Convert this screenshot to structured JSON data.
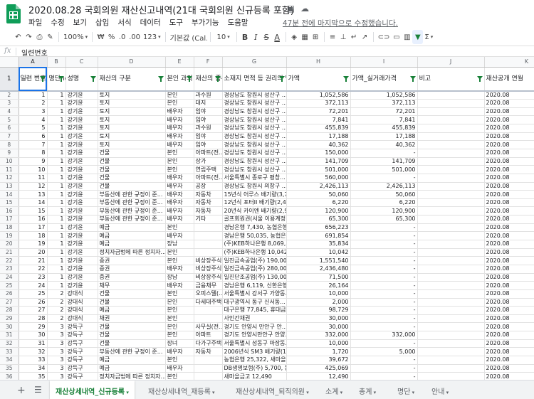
{
  "app": {
    "title": "2020.08.28 국회의원 재산신고내역(21대 국회의원 신규등록 포함)",
    "last_edit": "47분 전에 마지막으로 수정했습니다.",
    "menu": [
      "파일",
      "수정",
      "보기",
      "삽입",
      "서식",
      "데이터",
      "도구",
      "부가기능",
      "도움말"
    ]
  },
  "toolbar": {
    "zoom": "100%",
    "currency": "₩",
    "percent": "%",
    "dec_less": ".0",
    "dec_more": ".00",
    "format_more": "123",
    "font": "기본값 (Cal...",
    "font_size": "10",
    "bold": "B",
    "italic": "I",
    "strike": "S",
    "text_color": "A"
  },
  "formula": {
    "label": "fx",
    "value": "일련번호"
  },
  "columns": [
    "A",
    "B",
    "C",
    "D",
    "E",
    "F",
    "G",
    "H",
    "I",
    "J",
    "K"
  ],
  "header": {
    "row_number": "1",
    "cells": [
      "일련 번호",
      "명단no.",
      "성명",
      "재산의 구분",
      "본인 과의 관계",
      "재산의 종류",
      "소재지 면적 등 권리의 명세",
      "가액",
      "가액_실거래가격",
      "비고",
      "재산공개 연월"
    ]
  },
  "rows": [
    {
      "n": "2",
      "c": [
        "1",
        "1",
        "강기윤",
        "토지",
        "본인",
        "과수원",
        "경상남도 창원시 성산구 ...",
        "1,052,586",
        "1,052,586",
        "",
        "2020.08"
      ]
    },
    {
      "n": "3",
      "c": [
        "2",
        "1",
        "강기윤",
        "토지",
        "본인",
        "대지",
        "경상남도 창원시 성산구 ...",
        "372,113",
        "372,113",
        "",
        "2020.08"
      ]
    },
    {
      "n": "4",
      "c": [
        "3",
        "1",
        "강기윤",
        "토지",
        "배우자",
        "임야",
        "경상남도 창원시 성산구 ...",
        "72,201",
        "72,201",
        "",
        "2020.08"
      ]
    },
    {
      "n": "5",
      "c": [
        "4",
        "1",
        "강기윤",
        "토지",
        "배우자",
        "임야",
        "경상남도 창원시 성산구 ...",
        "7,841",
        "7,841",
        "",
        "2020.08"
      ]
    },
    {
      "n": "6",
      "c": [
        "5",
        "1",
        "강기윤",
        "토지",
        "배우자",
        "과수원",
        "경상남도 창원시 성산구 ...",
        "455,839",
        "455,839",
        "",
        "2020.08"
      ]
    },
    {
      "n": "7",
      "c": [
        "6",
        "1",
        "강기윤",
        "토지",
        "배우자",
        "임야",
        "경상남도 창원시 성산구 ...",
        "17,188",
        "17,188",
        "",
        "2020.08"
      ]
    },
    {
      "n": "8",
      "c": [
        "7",
        "1",
        "강기윤",
        "토지",
        "배우자",
        "임야",
        "경상남도 창원시 성산구 ...",
        "40,362",
        "40,362",
        "",
        "2020.08"
      ]
    },
    {
      "n": "9",
      "c": [
        "8",
        "1",
        "강기윤",
        "건물",
        "본인",
        "아파트(전...",
        "경상남도 창원시 성산구 ...",
        "150,000",
        "-",
        "",
        "2020.08"
      ]
    },
    {
      "n": "10",
      "c": [
        "9",
        "1",
        "강기윤",
        "건물",
        "본인",
        "상가",
        "경상남도 창원시 성산구 ...",
        "141,709",
        "141,709",
        "",
        "2020.08"
      ]
    },
    {
      "n": "11",
      "c": [
        "10",
        "1",
        "강기윤",
        "건물",
        "본인",
        "연립주택",
        "경상남도 창원시 성산구 ...",
        "501,000",
        "501,000",
        "",
        "2020.08"
      ]
    },
    {
      "n": "12",
      "c": [
        "11",
        "1",
        "강기윤",
        "건물",
        "배우자",
        "아파트(전...",
        "서울특별시 종로구 평창...",
        "560,000",
        "-",
        "",
        "2020.08"
      ]
    },
    {
      "n": "13",
      "c": [
        "12",
        "1",
        "강기윤",
        "건물",
        "배우자",
        "공장",
        "경상남도 창원시 의창구 ...",
        "2,426,113",
        "2,426,113",
        "",
        "2020.08"
      ]
    },
    {
      "n": "14",
      "c": [
        "13",
        "1",
        "강기윤",
        "부동산에 관한 규정이 준...",
        "배우자",
        "자동차",
        "15년식 어루스 배기량(3,7...",
        "50,060",
        "50,060",
        "",
        "2020.08"
      ]
    },
    {
      "n": "15",
      "c": [
        "14",
        "1",
        "강기윤",
        "부동산에 관한 규정이 준...",
        "배우자",
        "자동차",
        "12년식 포터II 배기량(2,4...",
        "6,220",
        "6,220",
        "",
        "2020.08"
      ]
    },
    {
      "n": "16",
      "c": [
        "15",
        "1",
        "강기윤",
        "부동산에 관한 규정이 준...",
        "배우자",
        "자동차",
        "20년식 카이엔 배기량(2,9...",
        "120,900",
        "120,900",
        "",
        "2020.08"
      ]
    },
    {
      "n": "17",
      "c": [
        "16",
        "1",
        "강기윤",
        "부동산에 관한 규정이 준...",
        "배우자",
        "기타",
        "골프회원권(서울 이용계정...",
        "65,300",
        "65,300",
        "",
        "2020.08"
      ]
    },
    {
      "n": "18",
      "c": [
        "17",
        "1",
        "강기윤",
        "예금",
        "본인",
        "",
        "경남은행 7,430, 농협은행...",
        "656,223",
        "-",
        "",
        "2020.08"
      ]
    },
    {
      "n": "19",
      "c": [
        "18",
        "1",
        "강기윤",
        "예금",
        "배우자",
        "",
        "경남은행 50,035, 농협은행...",
        "691,854",
        "-",
        "",
        "2020.08"
      ]
    },
    {
      "n": "20",
      "c": [
        "19",
        "1",
        "강기윤",
        "예금",
        "장남",
        "",
        "(주)KEB하나은행 8,069, 경...",
        "35,834",
        "-",
        "",
        "2020.08"
      ]
    },
    {
      "n": "21",
      "c": [
        "20",
        "1",
        "강기윤",
        "정치자금법에 따른 정치자...",
        "본인",
        "",
        "(주)KEB하나은행 10,042",
        "10,042",
        "-",
        "",
        "2020.08"
      ]
    },
    {
      "n": "22",
      "c": [
        "21",
        "1",
        "강기윤",
        "증권",
        "본인",
        "비상장주식",
        "일진금속공업(주) 190,000...",
        "1,551,540",
        "-",
        "",
        "2020.08"
      ]
    },
    {
      "n": "23",
      "c": [
        "22",
        "1",
        "강기윤",
        "증권",
        "배우자",
        "비상장주식",
        "일진금속공업(주) 280,000...",
        "2,436,480",
        "-",
        "",
        "2020.08"
      ]
    },
    {
      "n": "24",
      "c": [
        "23",
        "1",
        "강기윤",
        "증권",
        "장남",
        "비상장주식",
        "일진단조공업(주) 130,000...",
        "71,500",
        "-",
        "",
        "2020.08"
      ]
    },
    {
      "n": "25",
      "c": [
        "24",
        "1",
        "강기윤",
        "채무",
        "배우자",
        "금융채무",
        "경남은행 6,119, 신한은행...",
        "26,164",
        "-",
        "",
        "2020.08"
      ]
    },
    {
      "n": "26",
      "c": [
        "25",
        "2",
        "강대식",
        "건물",
        "본인",
        "오피스텔(...",
        "서울특별시 강서구 가양동...",
        "10,000",
        "-",
        "",
        "2020.08"
      ]
    },
    {
      "n": "27",
      "c": [
        "26",
        "2",
        "강대식",
        "건물",
        "본인",
        "다세대주택",
        "대구광역시 동구 신서동...",
        "2,000",
        "-",
        "",
        "2020.08"
      ]
    },
    {
      "n": "28",
      "c": [
        "27",
        "2",
        "강대식",
        "예금",
        "본인",
        "",
        "대구은행 77,845, 휴대금...",
        "98,729",
        "-",
        "",
        "2020.08"
      ]
    },
    {
      "n": "29",
      "c": [
        "28",
        "2",
        "강대식",
        "채권",
        "본인",
        "",
        "사인간채권",
        "30,000",
        "-",
        "",
        "2020.08"
      ]
    },
    {
      "n": "30",
      "c": [
        "29",
        "3",
        "강득구",
        "건물",
        "본인",
        "사무실(전...",
        "경기도 안양시 만안구 안...",
        "30,000",
        "-",
        "",
        "2020.08"
      ]
    },
    {
      "n": "31",
      "c": [
        "30",
        "3",
        "강득구",
        "건물",
        "본인",
        "아파트",
        "경기도 안양시만안구 안양...",
        "332,000",
        "332,000",
        "",
        "2020.08"
      ]
    },
    {
      "n": "32",
      "c": [
        "31",
        "3",
        "강득구",
        "건물",
        "장녀",
        "다가구주택",
        "서울특별시 성동구 마장동...",
        "10,000",
        "-",
        "",
        "2020.08"
      ]
    },
    {
      "n": "33",
      "c": [
        "32",
        "3",
        "강득구",
        "부동산에 관한 규정이 준...",
        "배우자",
        "자동차",
        "2006년식 SM3 배기량(1,5...",
        "1,720",
        "5,000",
        "",
        "2020.08"
      ]
    },
    {
      "n": "34",
      "c": [
        "33",
        "3",
        "강득구",
        "예금",
        "본인",
        "",
        "농협은행 25,322, 새마을...",
        "39,672",
        "-",
        "",
        "2020.08"
      ]
    },
    {
      "n": "35",
      "c": [
        "34",
        "3",
        "강득구",
        "예금",
        "배우자",
        "",
        "DB생명보험(주) 5,700, 동...",
        "425,069",
        "-",
        "",
        "2020.08"
      ]
    },
    {
      "n": "36",
      "c": [
        "35",
        "3",
        "강득구",
        "정치자금법에 따른 정치자...",
        "본인",
        "",
        "새마을금고 12,490",
        "12,490",
        "-",
        "",
        "2020.08"
      ]
    }
  ],
  "sheet_tabs": [
    "재산상세내역_신규등록",
    "재산상세내역_재등록",
    "재산상세내역_퇴직의원",
    "소계",
    "총계",
    "명단",
    "안내"
  ]
}
